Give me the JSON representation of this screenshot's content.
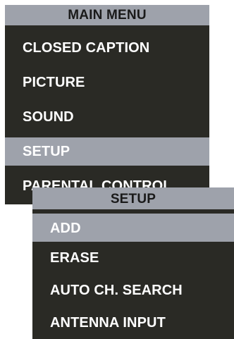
{
  "main_menu": {
    "title": "MAIN MENU",
    "items": [
      {
        "label": "CLOSED CAPTION",
        "selected": false
      },
      {
        "label": "PICTURE",
        "selected": false
      },
      {
        "label": "SOUND",
        "selected": false
      },
      {
        "label": "SETUP",
        "selected": true
      },
      {
        "label": "PARENTAL CONTROL",
        "selected": false
      }
    ]
  },
  "setup_menu": {
    "title": "SETUP",
    "items": [
      {
        "label": "ADD",
        "selected": true
      },
      {
        "label": "ERASE",
        "selected": false
      },
      {
        "label": "AUTO CH. SEARCH",
        "selected": false
      },
      {
        "label": "ANTENNA INPUT",
        "selected": false
      }
    ]
  },
  "colors": {
    "panel_background": "#2a2a25",
    "highlight": "#9ea2ab",
    "text": "#ffffff"
  }
}
